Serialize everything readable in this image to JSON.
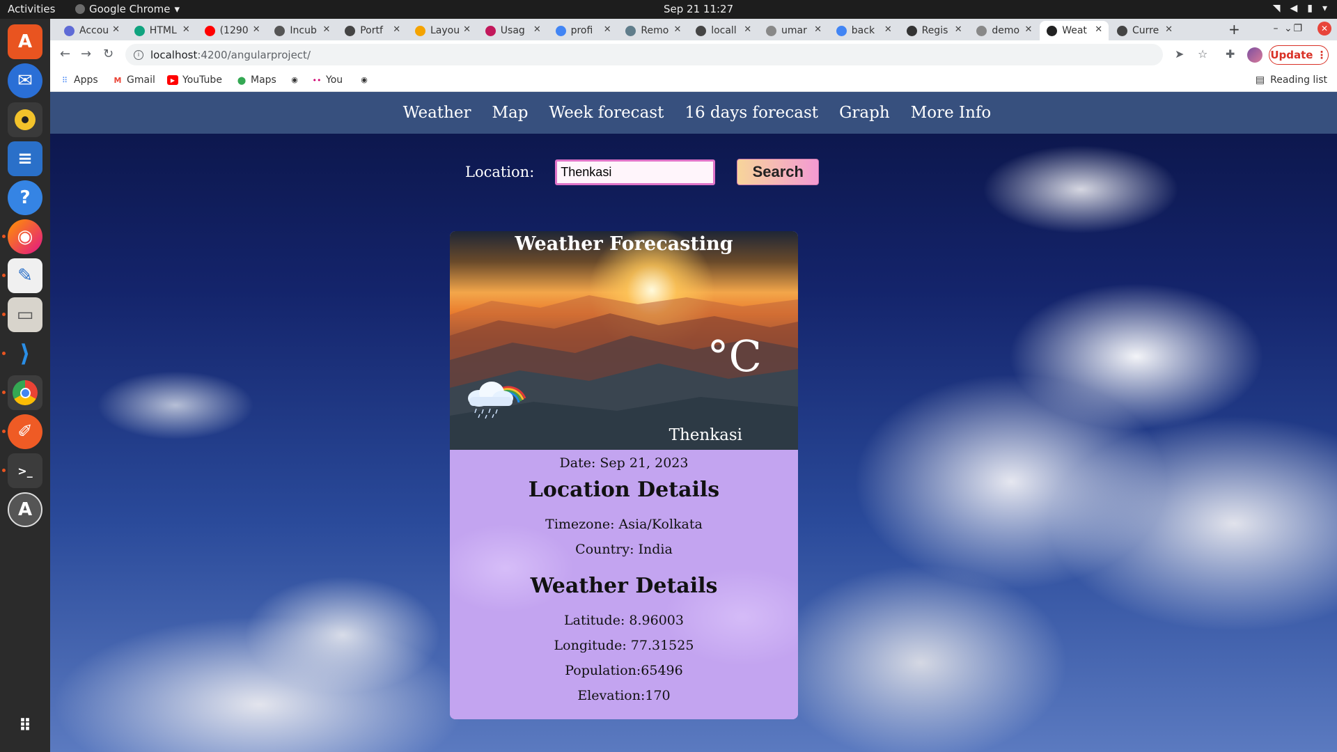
{
  "topbar": {
    "activities": "Activities",
    "app_name": "Google Chrome",
    "clock": "Sep 21  11:27"
  },
  "tabs": [
    {
      "label": "Accou",
      "color": "#5f6bd6"
    },
    {
      "label": "HTML",
      "color": "#10a37f"
    },
    {
      "label": "(1290",
      "color": "#ff0000"
    },
    {
      "label": "Incub",
      "color": "#555555"
    },
    {
      "label": "Portf",
      "color": "#444444"
    },
    {
      "label": "Layou",
      "color": "#f4a300"
    },
    {
      "label": "Usag",
      "color": "#c2185b"
    },
    {
      "label": "profi",
      "color": "#4285f4"
    },
    {
      "label": "Remo",
      "color": "#607d8b"
    },
    {
      "label": "locall",
      "color": "#444444"
    },
    {
      "label": "umar",
      "color": "#888888"
    },
    {
      "label": "back",
      "color": "#4285f4"
    },
    {
      "label": "Regis",
      "color": "#333333"
    },
    {
      "label": "demo",
      "color": "#888888"
    },
    {
      "label": "Weat",
      "color": "#222222",
      "active": true
    },
    {
      "label": "Curre",
      "color": "#444444"
    }
  ],
  "toolbar": {
    "url_host": "localhost",
    "url_path": ":4200/angularproject/",
    "update_label": "Update"
  },
  "bookmarks": {
    "apps": "Apps",
    "gmail": "Gmail",
    "youtube": "YouTube",
    "maps": "Maps",
    "you": "You",
    "reading_list": "Reading list"
  },
  "nav": {
    "items": [
      "Weather",
      "Map",
      "Week forecast",
      "16 days forecast",
      "Graph",
      "More Info"
    ]
  },
  "search": {
    "label": "Location:",
    "value": "Thenkasi",
    "button": "Search"
  },
  "card": {
    "title": "Weather Forecasting",
    "temperature_unit": "°C",
    "city": "Thenkasi",
    "date": "Date: Sep 21, 2023",
    "location_heading": "Location Details",
    "timezone": "Timezone: Asia/Kolkata",
    "country": "Country: India",
    "weather_heading": "Weather Details",
    "latitude": "Latitude: 8.96003",
    "longitude": "Longitude: 77.31525",
    "population": "Population:65496",
    "elevation": "Elevation:170"
  },
  "dock": {
    "icons": [
      "ubuntu-software-icon",
      "thunderbird-icon",
      "rhythmbox-icon",
      "libreoffice-writer-icon",
      "help-icon",
      "firefox-icon",
      "text-editor-icon",
      "files-icon",
      "vscode-icon",
      "chrome-icon",
      "postman-icon",
      "terminal-icon",
      "software-updater-icon",
      "show-apps-icon"
    ]
  }
}
